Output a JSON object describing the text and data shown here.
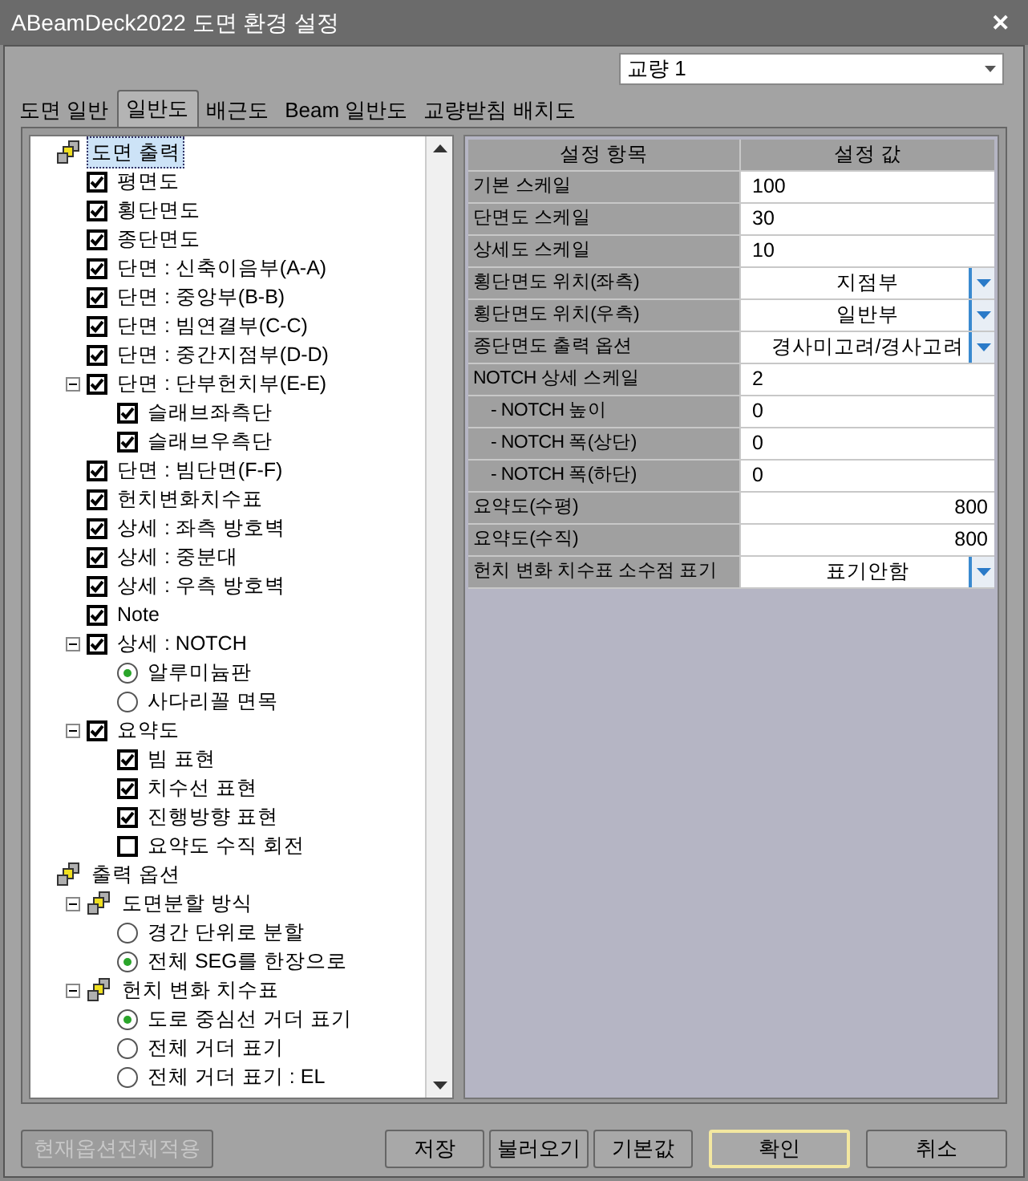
{
  "window": {
    "title": "ABeamDeck2022 도면 환경 설정",
    "close": "✕"
  },
  "bridge_select": {
    "value": "교량 1"
  },
  "tabs": [
    {
      "label": "도면 일반",
      "selected": false
    },
    {
      "label": "일반도",
      "selected": true
    },
    {
      "label": "배근도",
      "selected": false
    },
    {
      "label": "Beam 일반도",
      "selected": false
    },
    {
      "label": "교량받침 배치도",
      "selected": false
    }
  ],
  "tree": [
    {
      "kind": "group",
      "label": "도면 출력",
      "selected": true,
      "expanded": true,
      "children": [
        {
          "kind": "checkbox",
          "label": "평면도",
          "checked": true,
          "selected": false
        },
        {
          "kind": "checkbox",
          "label": "횡단면도",
          "checked": true,
          "selected": false
        },
        {
          "kind": "checkbox",
          "label": "종단면도",
          "checked": true,
          "selected": false
        },
        {
          "kind": "checkbox",
          "label": "단면 : 신축이음부(A-A)",
          "checked": true,
          "selected": false
        },
        {
          "kind": "checkbox",
          "label": "단면 : 중앙부(B-B)",
          "checked": true,
          "selected": false
        },
        {
          "kind": "checkbox",
          "label": "단면 : 빔연결부(C-C)",
          "checked": true,
          "selected": false
        },
        {
          "kind": "checkbox",
          "label": "단면 : 중간지점부(D-D)",
          "checked": true,
          "selected": false
        },
        {
          "kind": "checkbox",
          "label": "단면 : 단부헌치부(E-E)",
          "checked": true,
          "selected": false,
          "expanded": true,
          "children": [
            {
              "kind": "checkbox",
              "label": "슬래브좌측단",
              "checked": true,
              "selected": false
            },
            {
              "kind": "checkbox",
              "label": "슬래브우측단",
              "checked": true,
              "selected": false
            }
          ]
        },
        {
          "kind": "checkbox",
          "label": "단면 : 빔단면(F-F)",
          "checked": true,
          "selected": false
        },
        {
          "kind": "checkbox",
          "label": "헌치변화치수표",
          "checked": true,
          "selected": false
        },
        {
          "kind": "checkbox",
          "label": "상세 : 좌측 방호벽",
          "checked": true,
          "selected": false
        },
        {
          "kind": "checkbox",
          "label": "상세 : 중분대",
          "checked": true,
          "selected": false
        },
        {
          "kind": "checkbox",
          "label": "상세 : 우측 방호벽",
          "checked": true,
          "selected": false
        },
        {
          "kind": "checkbox",
          "label": "Note",
          "checked": true,
          "selected": false
        },
        {
          "kind": "checkbox",
          "label": "상세 : NOTCH",
          "checked": true,
          "selected": false,
          "expanded": true,
          "children": [
            {
              "kind": "radio",
              "label": "알루미늄판",
              "checked": true,
              "selected": false
            },
            {
              "kind": "radio",
              "label": "사다리꼴 면목",
              "checked": false,
              "selected": false
            }
          ]
        },
        {
          "kind": "checkbox",
          "label": "요약도",
          "checked": true,
          "selected": false,
          "expanded": true,
          "children": [
            {
              "kind": "checkbox",
              "label": "빔 표현",
              "checked": true,
              "selected": false
            },
            {
              "kind": "checkbox",
              "label": "치수선 표현",
              "checked": true,
              "selected": false
            },
            {
              "kind": "checkbox",
              "label": "진행방향 표현",
              "checked": true,
              "selected": false
            },
            {
              "kind": "checkbox",
              "label": "요약도 수직 회전",
              "checked": false,
              "selected": false
            }
          ]
        }
      ]
    },
    {
      "kind": "group",
      "label": "출력 옵션",
      "selected": false,
      "expanded": true,
      "children": [
        {
          "kind": "group",
          "label": "도면분할 방식",
          "selected": false,
          "expanded": true,
          "children": [
            {
              "kind": "radio",
              "label": "경간 단위로 분할",
              "checked": false,
              "selected": false
            },
            {
              "kind": "radio",
              "label": "전체 SEG를 한장으로",
              "checked": true,
              "selected": false
            }
          ]
        },
        {
          "kind": "group",
          "label": "헌치 변화 치수표",
          "selected": false,
          "expanded": true,
          "children": [
            {
              "kind": "radio",
              "label": "도로 중심선 거더 표기",
              "checked": true,
              "selected": false
            },
            {
              "kind": "radio",
              "label": "전체 거더 표기",
              "checked": false,
              "selected": false
            },
            {
              "kind": "radio",
              "label": "전체 거더 표기 : EL",
              "checked": false,
              "selected": false
            }
          ]
        }
      ]
    }
  ],
  "table": {
    "columns": [
      "설정 항목",
      "설정 값"
    ],
    "rows": [
      {
        "label": "기본 스케일",
        "value": "100",
        "kind": "text"
      },
      {
        "label": "단면도 스케일",
        "value": "30",
        "kind": "text"
      },
      {
        "label": "상세도 스케일",
        "value": "10",
        "kind": "text"
      },
      {
        "label": "횡단면도 위치(좌측)",
        "value": "지점부",
        "kind": "dropdown"
      },
      {
        "label": "횡단면도 위치(우측)",
        "value": "일반부",
        "kind": "dropdown"
      },
      {
        "label": "종단면도 출력 옵션",
        "value": "경사미고려/경사고려",
        "kind": "dropdown"
      },
      {
        "label": "NOTCH 상세 스케일",
        "value": "2",
        "kind": "text",
        "children": [
          {
            "label": "- NOTCH 높이",
            "value": "0",
            "kind": "text"
          },
          {
            "label": "- NOTCH 폭(상단)",
            "value": "0",
            "kind": "text"
          },
          {
            "label": "- NOTCH 폭(하단)",
            "value": "0",
            "kind": "text"
          }
        ]
      },
      {
        "label": "요약도(수평)",
        "value": "800",
        "kind": "number"
      },
      {
        "label": "요약도(수직)",
        "value": "800",
        "kind": "number"
      },
      {
        "label": "헌치 변화 치수표 소수점 표기",
        "value": "표기안함",
        "kind": "dropdown"
      }
    ]
  },
  "buttons": [
    {
      "label": "현재옵션전체적용",
      "disabled": true,
      "default": false
    },
    {
      "label": "저장",
      "disabled": false,
      "default": false
    },
    {
      "label": "불러오기",
      "disabled": false,
      "default": false
    },
    {
      "label": "기본값",
      "disabled": false,
      "default": false
    },
    {
      "label": "확인",
      "disabled": false,
      "default": true
    },
    {
      "label": "취소",
      "disabled": false,
      "default": false
    }
  ]
}
